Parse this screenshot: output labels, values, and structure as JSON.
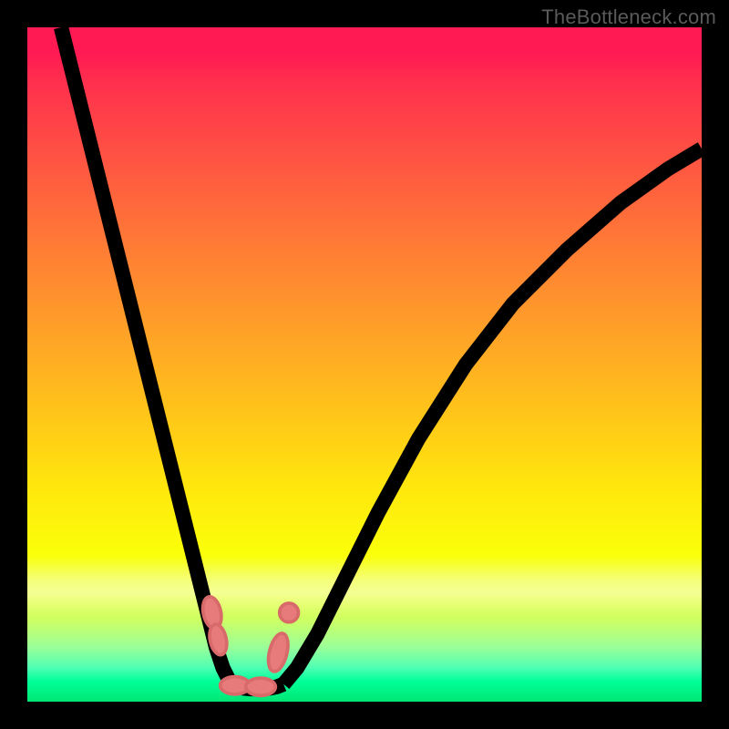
{
  "watermark": "TheBottleneck.com",
  "chart_data": {
    "type": "line",
    "title": "",
    "xlabel": "",
    "ylabel": "",
    "xlim": [
      0,
      100
    ],
    "ylim": [
      0,
      100
    ],
    "grid": false,
    "series": [
      {
        "name": "left-curve",
        "x": [
          5,
          7,
          9,
          11,
          13,
          15,
          17,
          19,
          21,
          22.5,
          24,
          25.5,
          27,
          28,
          29,
          30,
          31
        ],
        "y": [
          100,
          92,
          84,
          76,
          68,
          60,
          52,
          44,
          36,
          30,
          24,
          18,
          12,
          8,
          5,
          3,
          2.2
        ]
      },
      {
        "name": "valley-floor",
        "x": [
          31,
          32,
          33,
          34,
          35,
          36,
          37,
          38
        ],
        "y": [
          2.2,
          2.0,
          1.9,
          1.9,
          1.9,
          2.0,
          2.2,
          2.6
        ]
      },
      {
        "name": "right-curve",
        "x": [
          38,
          40,
          43,
          47,
          52,
          58,
          65,
          72,
          80,
          88,
          95,
          100
        ],
        "y": [
          2.6,
          5,
          10,
          18,
          28,
          39,
          50,
          59,
          67,
          74,
          79,
          82
        ]
      }
    ],
    "markers": [
      {
        "name": "left-upper-pill",
        "cx": 27.4,
        "cy": 13.2,
        "rx": 1.3,
        "ry": 2.4,
        "rot": -12
      },
      {
        "name": "left-lower-pill",
        "cx": 28.3,
        "cy": 9.2,
        "rx": 1.2,
        "ry": 2.3,
        "rot": -12
      },
      {
        "name": "right-upper-dot",
        "cx": 38.8,
        "cy": 13.2,
        "rx": 1.4,
        "ry": 1.4,
        "rot": 0
      },
      {
        "name": "right-lower-pill",
        "cx": 37.2,
        "cy": 7.3,
        "rx": 1.3,
        "ry": 2.9,
        "rot": 14
      },
      {
        "name": "floor-pill-1",
        "cx": 30.8,
        "cy": 2.4,
        "rx": 2.2,
        "ry": 1.3,
        "rot": 0
      },
      {
        "name": "floor-pill-2",
        "cx": 34.6,
        "cy": 2.2,
        "rx": 2.2,
        "ry": 1.3,
        "rot": 0
      }
    ],
    "background_gradient": {
      "top": "#ff1a53",
      "mid": "#ffe60d",
      "bottom": "#00e673"
    }
  }
}
